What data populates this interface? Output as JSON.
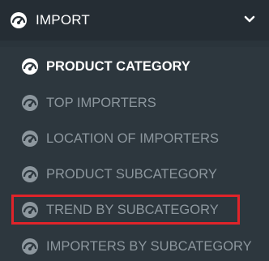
{
  "menu": {
    "header": {
      "label": "IMPORT",
      "icon": "dashboard-gauge-icon",
      "toggle_icon": "chevron-down-icon"
    },
    "items": [
      {
        "label": "PRODUCT CATEGORY",
        "icon": "dashboard-gauge-icon",
        "state": "active"
      },
      {
        "label": "TOP IMPORTERS",
        "icon": "dashboard-gauge-icon",
        "state": "normal"
      },
      {
        "label": "LOCATION OF IMPORTERS",
        "icon": "dashboard-gauge-icon",
        "state": "normal"
      },
      {
        "label": "PRODUCT SUBCATEGORY",
        "icon": "dashboard-gauge-icon",
        "state": "normal"
      },
      {
        "label": "TREND BY SUBCATEGORY",
        "icon": "dashboard-gauge-icon",
        "state": "highlighted"
      },
      {
        "label": "IMPORTERS BY SUBCATEGORY",
        "icon": "dashboard-gauge-icon",
        "state": "normal"
      }
    ]
  },
  "colors": {
    "header_background": "#252d34",
    "submenu_background": "#2d373e",
    "active_text": "#ffffff",
    "inactive_text": "#8d979e",
    "highlight_border": "#e0242a"
  }
}
